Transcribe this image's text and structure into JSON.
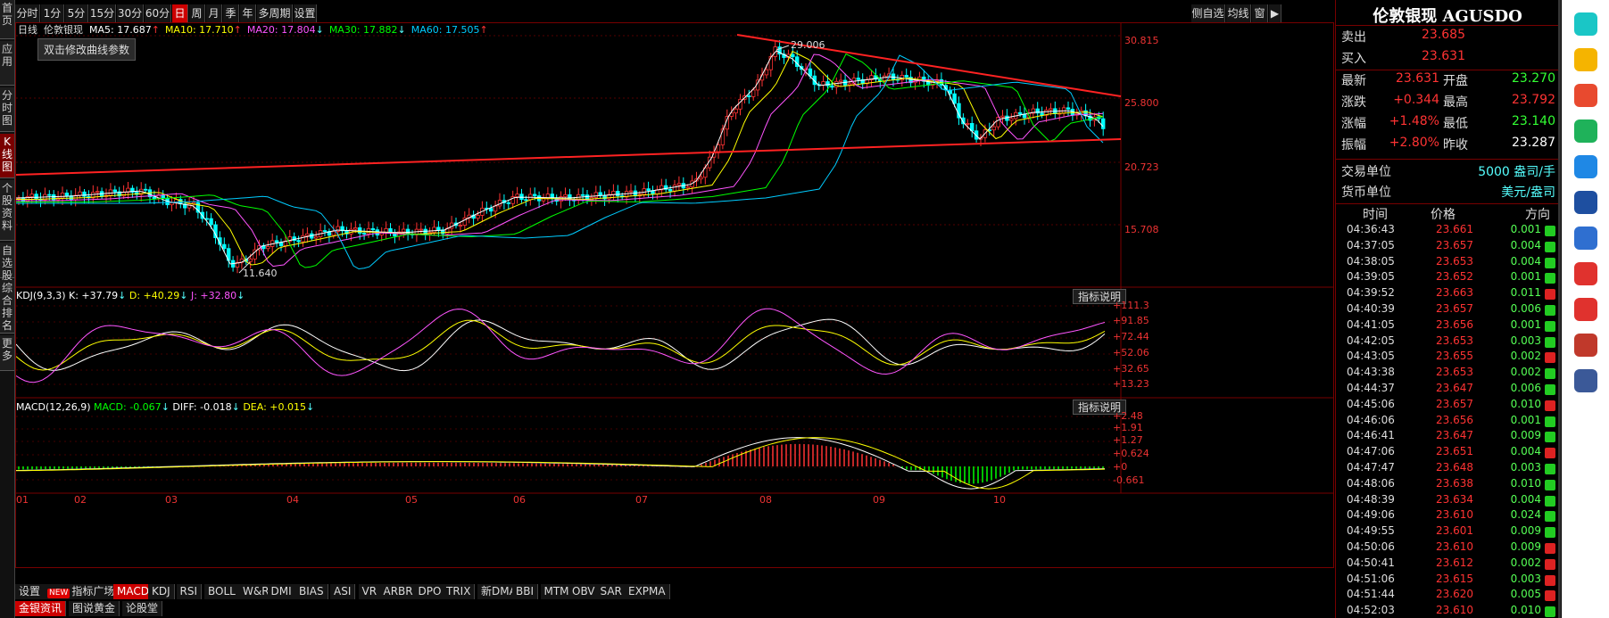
{
  "toolbar": {
    "periods": [
      "分时",
      "1分",
      "5分",
      "15分",
      "30分",
      "60分",
      "日",
      "周",
      "月",
      "季",
      "年",
      "多周期",
      "设置"
    ],
    "active_index": 6
  },
  "right_tools": [
    "侧自选",
    "均线",
    "窗"
  ],
  "left_nav": [
    "首页",
    "应用",
    "分时图",
    "K线图",
    "个股资料",
    "自选股",
    "综合排名",
    "更多"
  ],
  "left_nav_active": 3,
  "chart_header": {
    "type_label": "日线",
    "symbol_label": "伦敦银现",
    "ma": [
      {
        "label": "MA5: 17.687",
        "color": "#ffffff",
        "dir": "up"
      },
      {
        "label": "MA10: 17.710",
        "color": "#ffff00",
        "dir": "up"
      },
      {
        "label": "MA20: 17.804",
        "color": "#ff55ff",
        "dir": "down"
      },
      {
        "label": "MA30: 17.882",
        "color": "#00ff00",
        "dir": "down"
      },
      {
        "label": "MA60: 17.505",
        "color": "#00ccff",
        "dir": "up"
      }
    ]
  },
  "tooltip": "双击修改曲线参数",
  "price_axis": [
    "30.815",
    "25.800",
    "20.723",
    "15.708"
  ],
  "price_annotations": {
    "high": "29.006",
    "low": "11.640"
  },
  "kdj": {
    "title": "KDJ(9,3,3)",
    "k": "K: +37.79",
    "d": "D: +40.29",
    "j": "J: +32.80",
    "axis": [
      "+111.3",
      "+91.85",
      "+72.44",
      "+52.06",
      "+32.65",
      "+13.23"
    ],
    "button": "指标说明"
  },
  "macd": {
    "title": "MACD(12,26,9)",
    "macd": "MACD: -0.067",
    "diff": "DIFF: -0.018",
    "dea": "DEA: +0.015",
    "axis": [
      "+2.48",
      "+1.91",
      "+1.27",
      "+0.624",
      "+0",
      "-0.661"
    ],
    "button": "指标说明"
  },
  "months": [
    "01",
    "02",
    "03",
    "04",
    "05",
    "06",
    "07",
    "08",
    "09",
    "10"
  ],
  "indicator_tabs": {
    "settings": "设置",
    "new_badge": "NEW",
    "items": [
      "指标广场",
      "MACD",
      "KDJ",
      "RSI",
      "BOLL",
      "W&R",
      "DMI",
      "BIAS",
      "ASI",
      "VR",
      "ARBR",
      "DPO",
      "TRIX",
      "新DMA",
      "BBI",
      "MTM",
      "OBV",
      "SAR",
      "EXPMA"
    ],
    "active": "MACD"
  },
  "news_tabs": {
    "items": [
      "金银资讯",
      "图说黄金",
      "论股堂"
    ],
    "active": "金银资讯"
  },
  "quote": {
    "title": "伦敦银现 AGUSDO",
    "sell_label": "卖出",
    "sell": "23.685",
    "buy_label": "买入",
    "buy": "23.631",
    "rows": [
      {
        "l1": "最新",
        "v1": "23.631",
        "c1": "red",
        "l2": "开盘",
        "v2": "23.270",
        "c2": "green"
      },
      {
        "l1": "涨跌",
        "v1": "+0.344",
        "c1": "red",
        "l2": "最高",
        "v2": "23.792",
        "c2": "red"
      },
      {
        "l1": "涨幅",
        "v1": "+1.48%",
        "c1": "red",
        "l2": "最低",
        "v2": "23.140",
        "c2": "green"
      },
      {
        "l1": "振幅",
        "v1": "+2.80%",
        "c1": "red",
        "l2": "昨收",
        "v2": "23.287",
        "c2": "white"
      }
    ],
    "unit_label": "交易单位",
    "unit": "5000 盎司/手",
    "currency_label": "货币单位",
    "currency": "美元/盎司",
    "tick_headers": [
      "时间",
      "价格",
      "方向"
    ],
    "ticks": [
      [
        "04:36:43",
        "23.661",
        "0.001",
        "dn"
      ],
      [
        "04:37:05",
        "23.657",
        "0.004",
        "dn"
      ],
      [
        "04:38:05",
        "23.653",
        "0.004",
        "dn"
      ],
      [
        "04:39:05",
        "23.652",
        "0.001",
        "dn"
      ],
      [
        "04:39:52",
        "23.663",
        "0.011",
        "up"
      ],
      [
        "04:40:39",
        "23.657",
        "0.006",
        "dn"
      ],
      [
        "04:41:05",
        "23.656",
        "0.001",
        "dn"
      ],
      [
        "04:42:05",
        "23.653",
        "0.003",
        "dn"
      ],
      [
        "04:43:05",
        "23.655",
        "0.002",
        "up"
      ],
      [
        "04:43:38",
        "23.653",
        "0.002",
        "dn"
      ],
      [
        "04:44:37",
        "23.647",
        "0.006",
        "dn"
      ],
      [
        "04:45:06",
        "23.657",
        "0.010",
        "up"
      ],
      [
        "04:46:06",
        "23.656",
        "0.001",
        "dn"
      ],
      [
        "04:46:41",
        "23.647",
        "0.009",
        "dn"
      ],
      [
        "04:47:06",
        "23.651",
        "0.004",
        "up"
      ],
      [
        "04:47:47",
        "23.648",
        "0.003",
        "dn"
      ],
      [
        "04:48:06",
        "23.638",
        "0.010",
        "dn"
      ],
      [
        "04:48:39",
        "23.634",
        "0.004",
        "dn"
      ],
      [
        "04:49:06",
        "23.610",
        "0.024",
        "dn"
      ],
      [
        "04:49:55",
        "23.601",
        "0.009",
        "dn"
      ],
      [
        "04:50:06",
        "23.610",
        "0.009",
        "up"
      ],
      [
        "04:50:41",
        "23.612",
        "0.002",
        "up"
      ],
      [
        "04:51:06",
        "23.615",
        "0.003",
        "up"
      ],
      [
        "04:51:44",
        "23.620",
        "0.005",
        "up"
      ],
      [
        "04:52:03",
        "23.610",
        "0.010",
        "dn"
      ]
    ]
  },
  "sidebar_icons": [
    "plus-icon",
    "star-icon",
    "weibo-icon",
    "mail-icon",
    "p-app-icon",
    "tongshi-icon",
    "doc-icon",
    "free-novel-icon",
    "red-packet-icon",
    "game-icon",
    "game2-icon"
  ],
  "colors": {
    "up": "#ff3333",
    "down": "#00ffff",
    "accent": "#cc0000"
  }
}
